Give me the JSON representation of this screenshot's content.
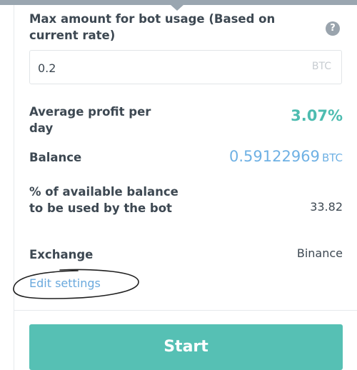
{
  "max_amount": {
    "label": "Max amount for bot usage (Based on current rate)",
    "help_icon": "question-icon",
    "help_symbol": "?",
    "value": "0.2",
    "unit": "BTC"
  },
  "stats": {
    "profit": {
      "label": "Average profit per day",
      "value": "3.07%"
    },
    "balance": {
      "label": "Balance",
      "value": "0.59122969",
      "unit": "BTC"
    },
    "percent_available": {
      "label": "% of available balance to be used by the bot",
      "value": "33.82"
    },
    "exchange": {
      "label": "Exchange",
      "value": "Binance"
    }
  },
  "edit_settings_label": "Edit settings",
  "start_label": "Start",
  "colors": {
    "accent_teal": "#56c0b4",
    "profit_green": "#4dbcb0",
    "balance_blue": "#6fb1e4",
    "link_blue": "#6aa9dd"
  }
}
